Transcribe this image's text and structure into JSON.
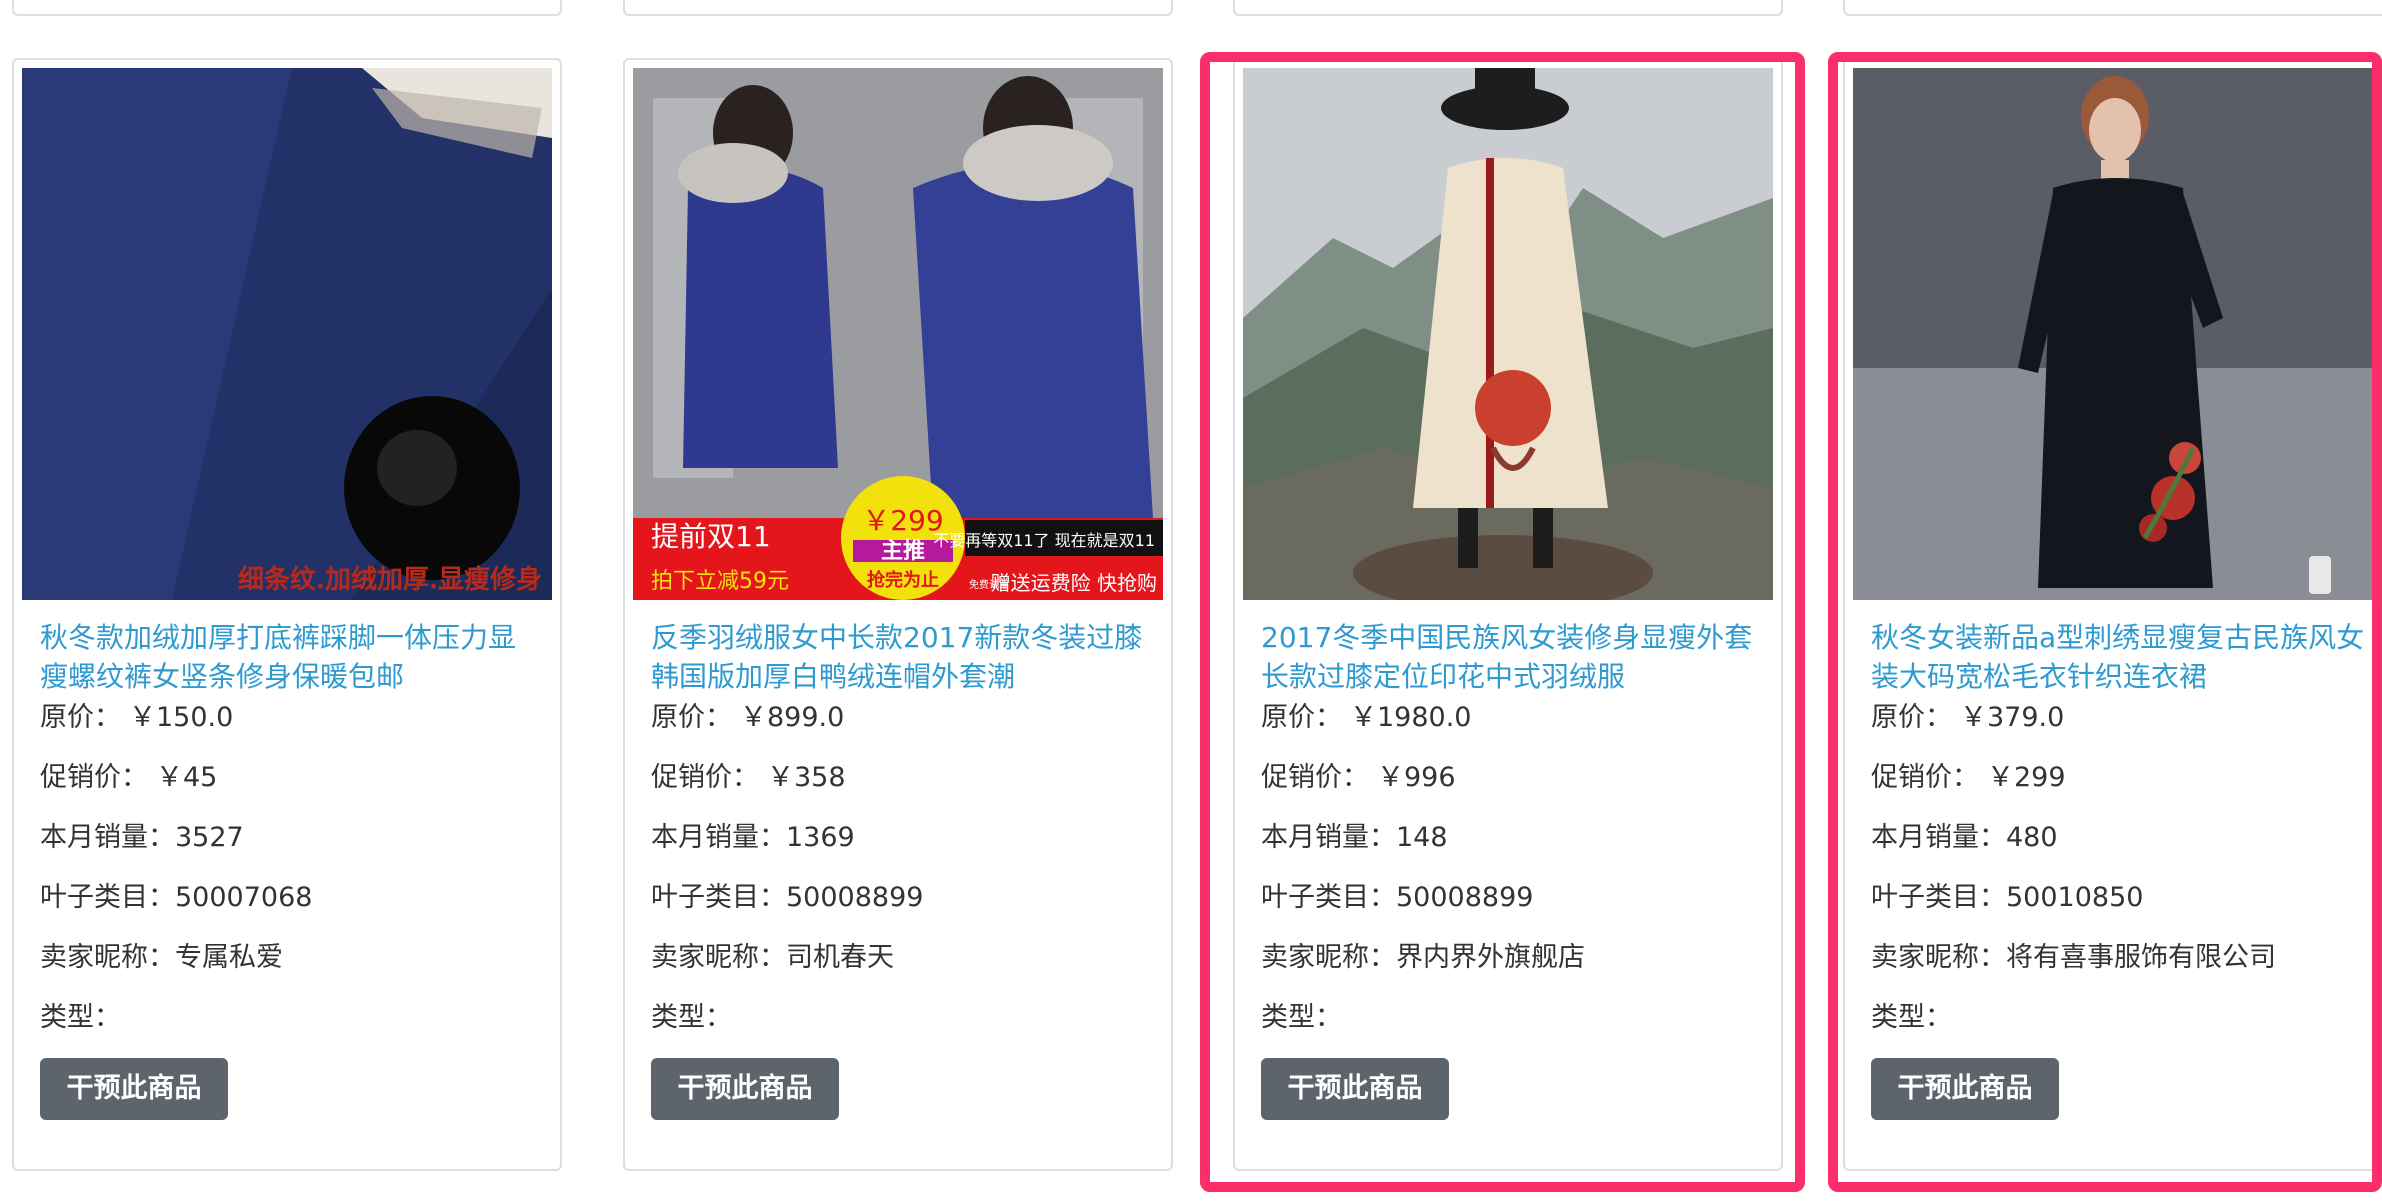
{
  "labels": {
    "original_price": "原价：",
    "promo_price": "促销价：",
    "monthly_sales": "本月销量：",
    "leaf_category": "叶子类目：",
    "seller_nick": "卖家昵称：",
    "type": "类型："
  },
  "products": [
    {
      "title": "秋冬款加绒加厚打底裤踩脚一体压力显\n瘦螺纹裤女竖条修身保暖包邮",
      "original_price": "￥150.0",
      "promo_price": "￥45",
      "monthly_sales": "3527",
      "leaf_category": "50007068",
      "seller_nick": "专属私爱",
      "type": "",
      "button": "干预此商品",
      "image_caption": "细条纹.加绒加厚.显瘦修身",
      "highlighted": false
    },
    {
      "title": "反季羽绒服女中长款2017新款冬装过膝\n韩国版加厚白鸭绒连帽外套潮",
      "original_price": "￥899.0",
      "promo_price": "￥358",
      "monthly_sales": "1369",
      "leaf_category": "50008899",
      "seller_nick": "司机春天",
      "type": "",
      "button": "干预此商品",
      "image_banner": {
        "left_top": "提前双11",
        "left_bottom": "拍下立减59元",
        "badge_price": "￥299",
        "badge_main": "主推",
        "badge_sub": "抢完为止",
        "right_top": "不要再等双11了  现在就是双11",
        "right_bottom_small": "免费试穿",
        "right_bottom": "赠送运费险  快抢购"
      },
      "highlighted": false
    },
    {
      "title": "2017冬季中国民族风女装修身显瘦外套\n长款过膝定位印花中式羽绒服",
      "original_price": "￥1980.0",
      "promo_price": "￥996",
      "monthly_sales": "148",
      "leaf_category": "50008899",
      "seller_nick": "界内界外旗舰店",
      "type": "",
      "button": "干预此商品",
      "highlighted": true
    },
    {
      "title": "秋冬女装新品a型刺绣显瘦复古民族风女\n装大码宽松毛衣针织连衣裙",
      "original_price": "￥379.0",
      "promo_price": "￥299",
      "monthly_sales": "480",
      "leaf_category": "50010850",
      "seller_nick": "将有喜事服饰有限公司",
      "type": "",
      "button": "干预此商品",
      "highlighted": true
    }
  ],
  "colors": {
    "link": "#2e9ad0",
    "button_bg": "#5d646c",
    "highlight": "#fb2d6b",
    "card_border": "#dedede"
  }
}
